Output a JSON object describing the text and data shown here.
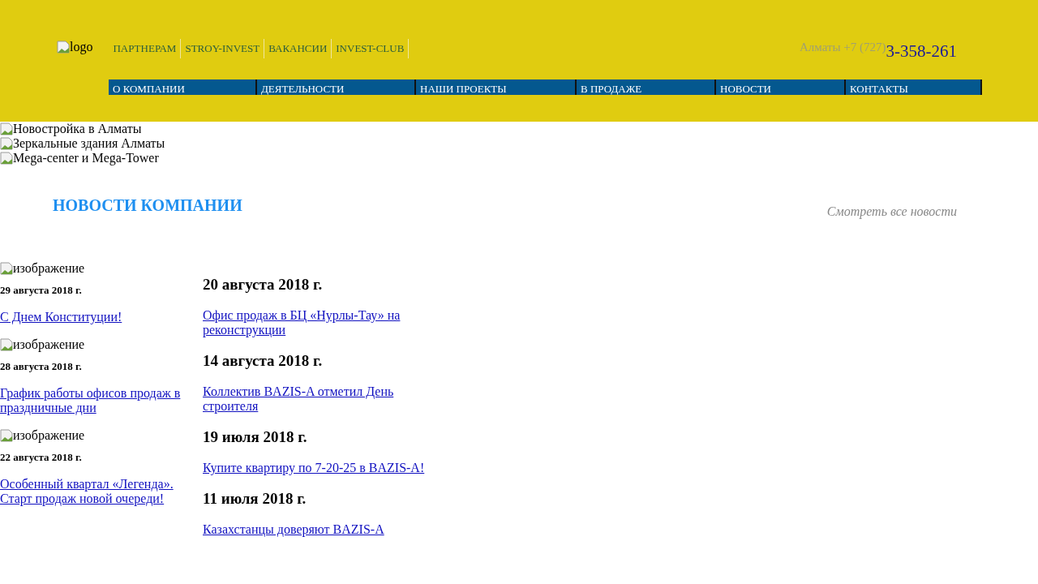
{
  "header": {
    "logo_alt": "logo",
    "top_links": [
      "ПАРТНЕРАМ",
      "STROY-INVEST",
      "ВАКАНСИИ",
      "INVEST-CLUB"
    ],
    "phone": {
      "prefix": "Алматы +7 (727)",
      "number": "3-358-261"
    },
    "nav": [
      "О КОМПАНИИ",
      "ДЕЯТЕЛЬНОСТИ",
      "НАШИ ПРОЕКТЫ",
      "В ПРОДАЖЕ",
      "НОВОСТИ",
      "КОНТАКТЫ"
    ]
  },
  "slider": [
    "Новостройка в Алматы",
    "Зеркальные здания Алматы",
    "Mega-center и Mega-Tower"
  ],
  "news": {
    "title": "НОВОСТИ КОМПАНИИ",
    "all_link": "Смотреть все новости",
    "featured": [
      {
        "image_alt": "изображение",
        "date": "29 августа 2018 г.",
        "title": "С Днем Конституции!"
      },
      {
        "image_alt": "изображение",
        "date": "28 августа 2018 г.",
        "title": "График работы офисов продаж в праздничные дни"
      },
      {
        "image_alt": "изображение",
        "date": "22 августа 2018 г.",
        "title": "Особенный квартал «Легенда». Старт продаж новой очереди!"
      }
    ],
    "list": [
      {
        "date": "20 августа 2018 г.",
        "title": "Офис продаж в БЦ «Нурлы-Тау» на реконструкции"
      },
      {
        "date": "14 августа 2018 г.",
        "title": "Коллектив BAZIS-A отметил День строителя"
      },
      {
        "date": "19 июля 2018 г.",
        "title": "Купите квартиру по 7-20-25 в BAZIS-A!"
      },
      {
        "date": "11 июля 2018 г.",
        "title": "Казахстанцы доверяют BAZIS-A"
      }
    ]
  }
}
